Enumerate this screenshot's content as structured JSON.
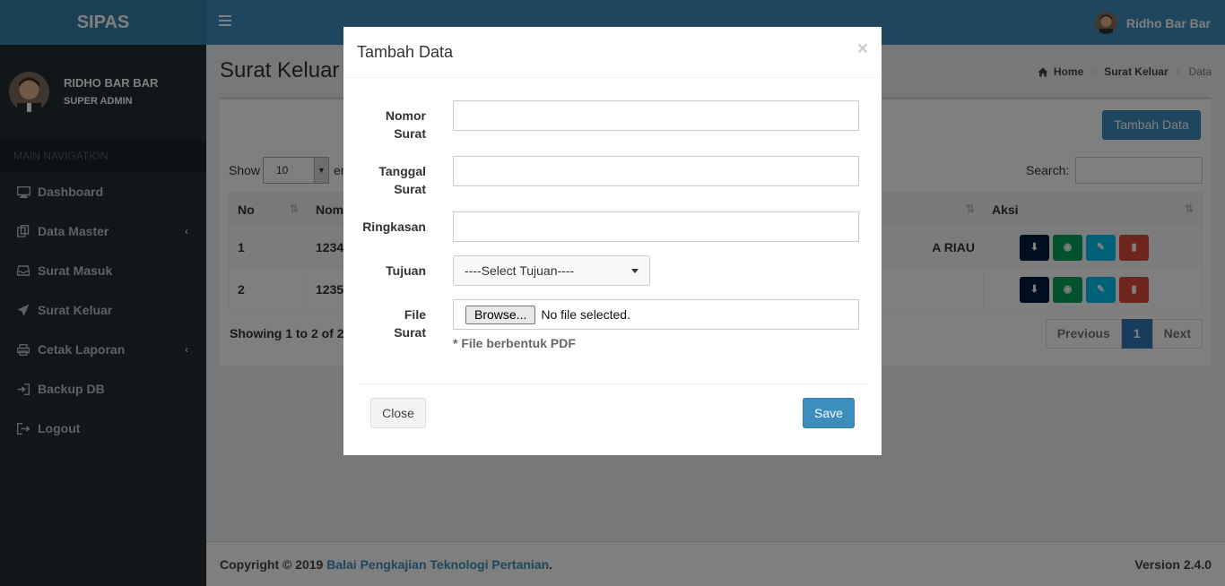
{
  "app": {
    "logo": "SIPAS"
  },
  "navbar": {
    "user_name": "Ridho Bar Bar"
  },
  "user_panel": {
    "name": "RIDHO BAR BAR",
    "role": "SUPER ADMIN"
  },
  "sidebar": {
    "header": "MAIN NAVIGATION",
    "items": [
      {
        "label": "Dashboard",
        "icon": "monitor-icon",
        "has_submenu": false
      },
      {
        "label": "Data Master",
        "icon": "copy-icon",
        "has_submenu": true
      },
      {
        "label": "Surat Masuk",
        "icon": "inbox-icon",
        "has_submenu": false
      },
      {
        "label": "Surat Keluar",
        "icon": "send-icon",
        "has_submenu": false
      },
      {
        "label": "Cetak Laporan",
        "icon": "print-icon",
        "has_submenu": true
      },
      {
        "label": "Backup DB",
        "icon": "sign-in-icon",
        "has_submenu": false
      },
      {
        "label": "Logout",
        "icon": "sign-out-icon",
        "has_submenu": false
      }
    ]
  },
  "page": {
    "title": "Surat Keluar",
    "breadcrumb": [
      "Home",
      "Surat Keluar",
      "Data"
    ]
  },
  "box": {
    "add_button": "Tambah Data",
    "show_label": "Show",
    "length_value": "10",
    "entries_label": "en",
    "search_label": "Search:",
    "columns": [
      "No",
      "Nom",
      "Aksi"
    ],
    "rows": [
      {
        "no": "1",
        "nomor": "1234",
        "tail": "A RIAU"
      },
      {
        "no": "2",
        "nomor": "1235",
        "tail": ""
      }
    ],
    "showing": "Showing 1 to 2 of 2",
    "pager": {
      "prev": "Previous",
      "current": "1",
      "next": "Next"
    }
  },
  "modal": {
    "title": "Tambah Data",
    "close_x": "×",
    "fields": {
      "nomor_label_1": "Nomor",
      "nomor_label_2": "Surat",
      "nomor_value": "",
      "tanggal_label_1": "Tanggal",
      "tanggal_label_2": "Surat",
      "tanggal_value": "",
      "ringkasan_label": "Ringkasan",
      "ringkasan_value": "",
      "tujuan_label": "Tujuan",
      "tujuan_selected": "----Select Tujuan----",
      "file_label_1": "File",
      "file_label_2": "Surat",
      "browse_label": "Browse...",
      "file_status": "No file selected.",
      "file_help": "* File berbentuk PDF"
    },
    "close_button": "Close",
    "save_button": "Save"
  },
  "footer": {
    "copyright": "Copyright © 2019",
    "org_link": "Balai Pengkajian Teknologi Pertanian",
    "period": ".",
    "version": "Version 2.4.0"
  },
  "colors": {
    "navbar": "#3c8dbc",
    "logo_bg": "#367fa9",
    "sidebar": "#222d32",
    "btn_download": "#001f3f",
    "btn_view": "#00a65a",
    "btn_edit": "#00c0ef",
    "btn_delete": "#dd4b39"
  }
}
